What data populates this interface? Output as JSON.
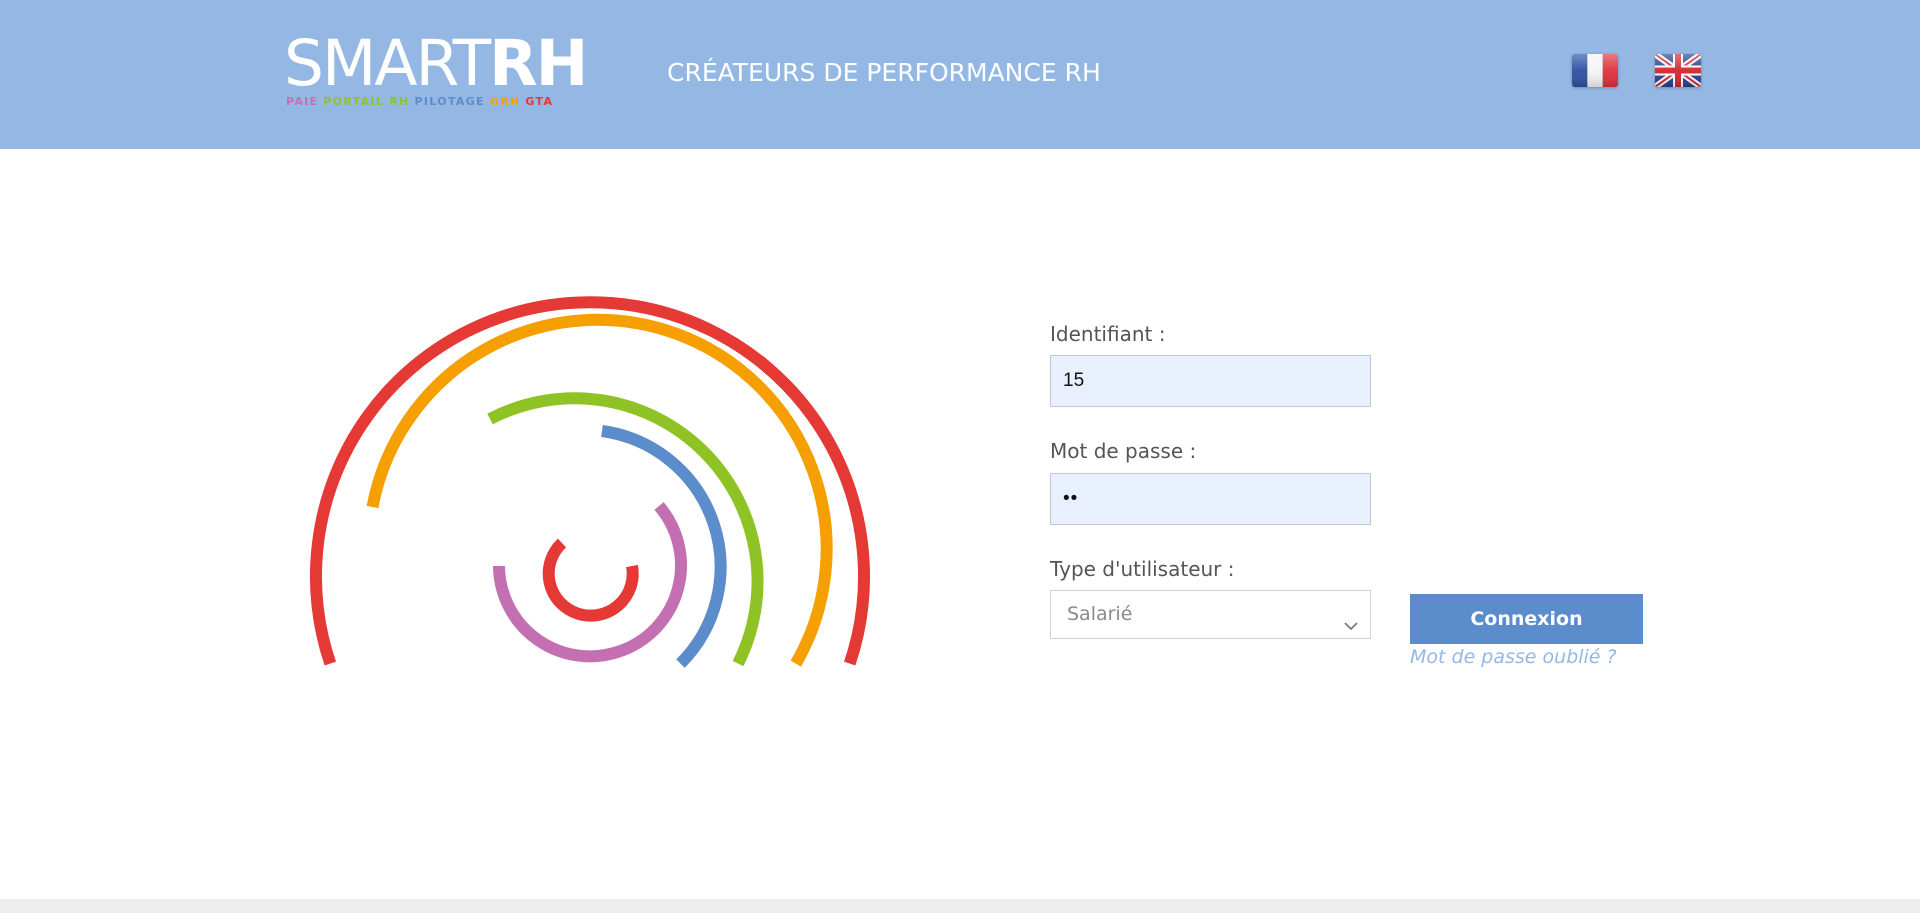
{
  "header": {
    "logo": {
      "main_thin": "SMART",
      "main_bold": "RH",
      "products": [
        {
          "label": "PAIE",
          "color": "#c46fb1"
        },
        {
          "label": "PORTAIL RH",
          "color": "#8fc225"
        },
        {
          "label": "PILOTAGE",
          "color": "#5b8ccc"
        },
        {
          "label": "GRH",
          "color": "#f5a000"
        },
        {
          "label": "GTA",
          "color": "#e53935"
        }
      ]
    },
    "tagline": "CRÉATEURS DE PERFORMANCE RH",
    "flags": [
      {
        "name": "french-flag-icon",
        "lang": "fr"
      },
      {
        "name": "uk-flag-icon",
        "lang": "en"
      }
    ]
  },
  "decor": {
    "arc_colors": [
      "#e53935",
      "#f5a000",
      "#8fc225",
      "#5b8ccc",
      "#c46fb1",
      "#e53935"
    ]
  },
  "form": {
    "identifiant_label": "Identifiant :",
    "identifiant_value": "15",
    "password_label": "Mot de passe :",
    "password_value": "••",
    "user_type_label": "Type d'utilisateur :",
    "user_type_value": "Salarié",
    "submit_label": "Connexion",
    "forgot_label": "Mot de passe oublié ?"
  },
  "colors": {
    "header_bg": "#94b8e3",
    "button_bg": "#5b8ccc",
    "input_bg": "#e8f0fe",
    "link": "#94b8e3"
  }
}
